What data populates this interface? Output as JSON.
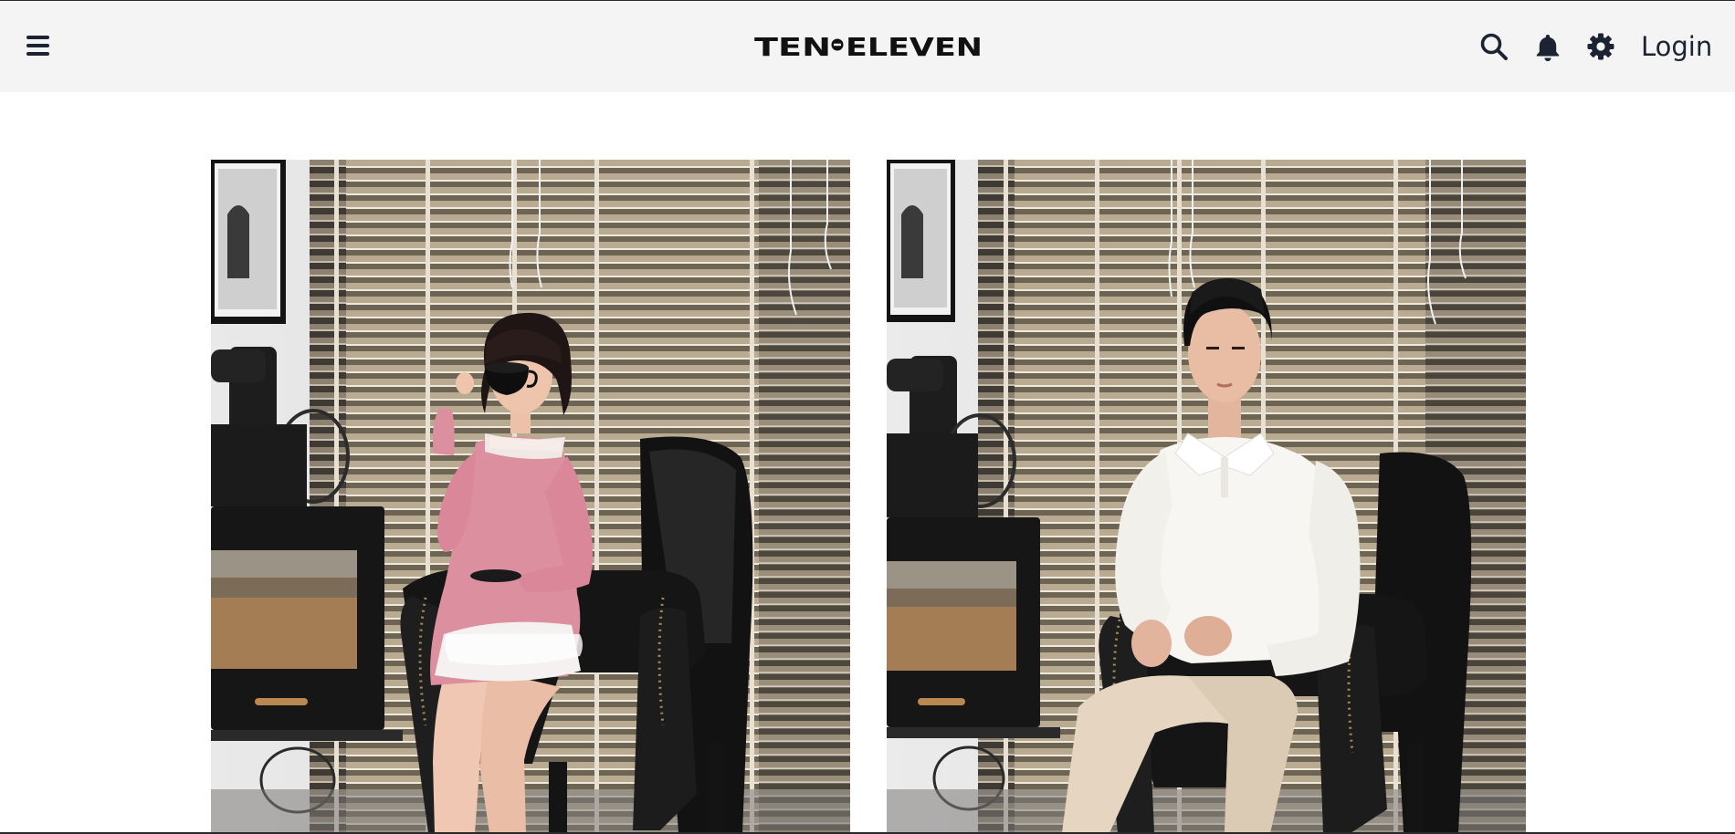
{
  "header": {
    "brand": "TEN ELEVEN",
    "brand_left": "TEN",
    "brand_right": "ELEVEN",
    "login_label": "Login",
    "icons": {
      "menu": "hamburger-menu-icon",
      "search": "search-icon",
      "notifications": "bell-icon",
      "settings": "gear-icon"
    }
  },
  "gallery": {
    "items": [
      {
        "subject": "model in pink dress seated in black leather armchair with teacup"
      },
      {
        "subject": "model in white polo shirt and beige trousers seated in black leather armchair"
      }
    ]
  },
  "colors": {
    "header_bg": "#f4f4f4",
    "page_bg": "#ffffff",
    "icon": "#1c2333",
    "brand": "#111111"
  }
}
